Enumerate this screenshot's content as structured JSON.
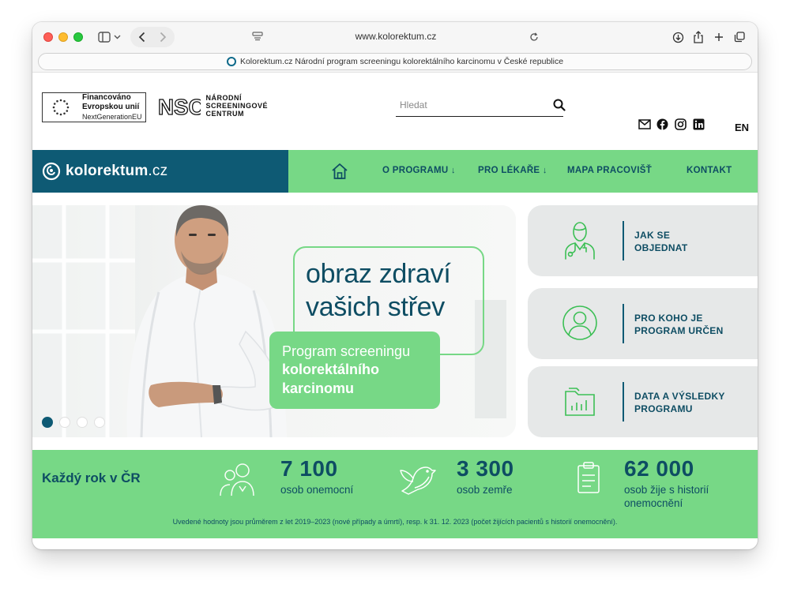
{
  "browser": {
    "url": "www.kolorektum.cz",
    "info_bar": "Kolorektum.cz Národní program screeningu kolorektálního karcinomu v České republice"
  },
  "header": {
    "eu_funded_line1": "Financováno",
    "eu_funded_line2": "Evropskou unií",
    "eu_funded_line3": "NextGenerationEU",
    "nsc_logo": "NSC",
    "nsc_line1": "NÁRODNÍ",
    "nsc_line2": "SCREENINGOVÉ",
    "nsc_line3": "CENTRUM",
    "search_placeholder": "Hledat",
    "language": "EN",
    "social_icons": [
      "mail-icon",
      "facebook-icon",
      "instagram-icon",
      "linkedin-icon"
    ]
  },
  "brand": {
    "name": "kolorektum",
    "tld": ".cz"
  },
  "nav": {
    "items": [
      {
        "label": "O PROGRAMU",
        "arrow": "↓"
      },
      {
        "label": "PRO LÉKAŘE",
        "arrow": "↓"
      },
      {
        "label": "MAPA PRACOVIŠŤ"
      },
      {
        "label": "KONTAKT"
      }
    ]
  },
  "hero": {
    "tagline_line1": "obraz zdraví",
    "tagline_line2": "vašich střev",
    "box_line1": "Program screeningu",
    "box_line2": "kolorektálního",
    "box_line3": "karcinomu",
    "slides": 4,
    "active_slide": 1
  },
  "cards": [
    {
      "line1": "JAK SE",
      "line2": "OBJEDNAT",
      "icon": "doctor-icon"
    },
    {
      "line1": "PRO KOHO JE",
      "line2": "PROGRAM URČEN",
      "icon": "person-icon"
    },
    {
      "line1": "DATA A VÝSLEDKY",
      "line2": "PROGRAMU",
      "icon": "data-folder-icon"
    }
  ],
  "stats": {
    "title": "Každý rok v ČR",
    "items": [
      {
        "number": "7 100",
        "label_line1": "osob onemocní",
        "label_line2": "",
        "icon": "people-icon"
      },
      {
        "number": "3 300",
        "label_line1": "osob zemře",
        "label_line2": "",
        "icon": "dove-icon"
      },
      {
        "number": "62 000",
        "label_line1": "osob žije s historií",
        "label_line2": "onemocnění",
        "icon": "clipboard-icon"
      }
    ],
    "note": "Uvedené hodnoty jsou průměrem z let 2019–2023 (nové případy a úmrtí), resp. k 31. 12. 2023 (počet žijících pacientů s historií onemocnění)."
  },
  "colors": {
    "accent_green": "#77d886",
    "brand_teal": "#0e5a74",
    "card_grey": "#e6e8e8"
  }
}
